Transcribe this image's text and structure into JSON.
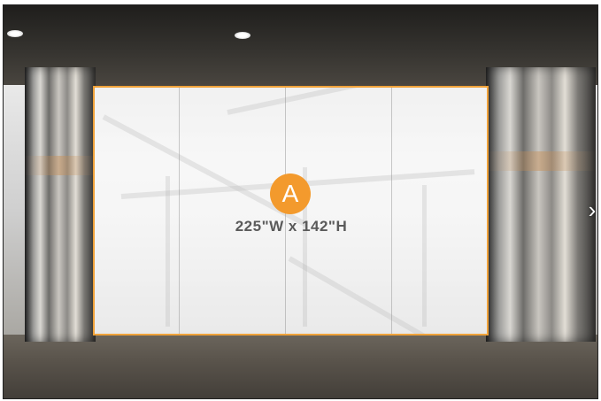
{
  "screen": {
    "marker_label": "A",
    "dimensions": "225\"W x 142\"H"
  },
  "colors": {
    "accent": "#f39a2d",
    "screen_border": "#f0a23a"
  },
  "controls": {
    "next_icon": "chevron-right-icon",
    "next_glyph": "›"
  }
}
